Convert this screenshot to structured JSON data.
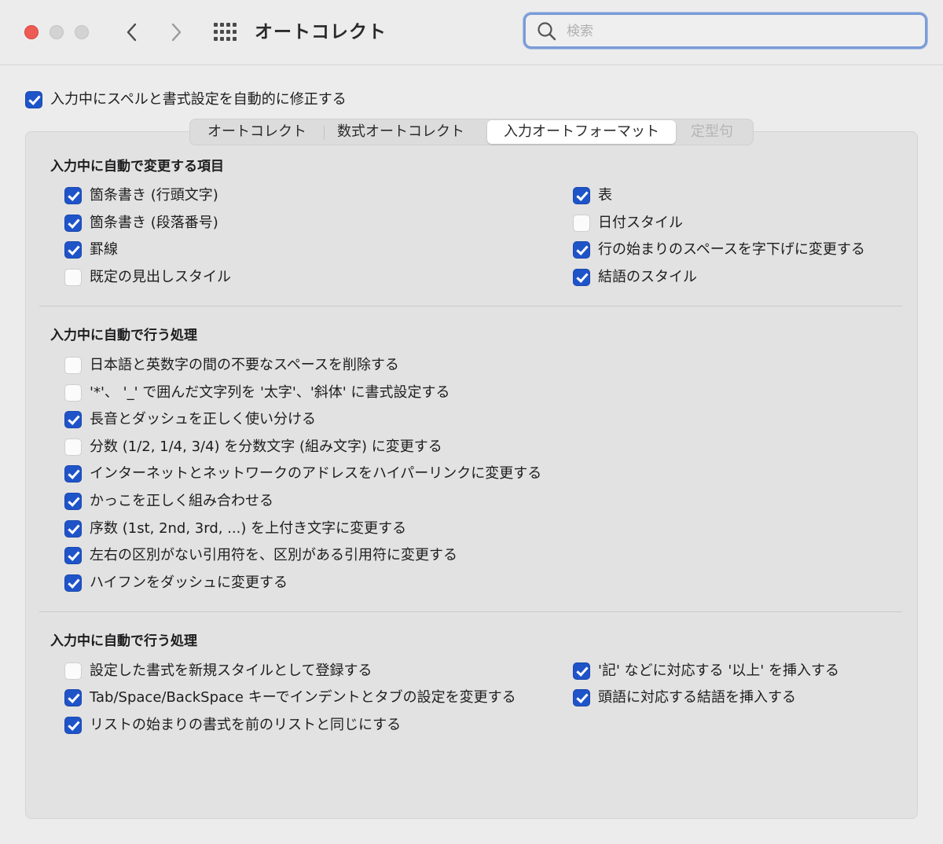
{
  "window": {
    "title": "オートコレクト",
    "search": {
      "placeholder": "検索",
      "value": ""
    }
  },
  "master": {
    "label": "入力中にスペルと書式設定を自動的に修正する",
    "checked": true
  },
  "tabs": [
    {
      "label": "オートコレクト",
      "state": "normal"
    },
    {
      "label": "数式オートコレクト",
      "state": "normal"
    },
    {
      "label": "入力オートフォーマット",
      "state": "selected"
    },
    {
      "label": "定型句",
      "state": "disabled"
    }
  ],
  "sections": [
    {
      "heading": "入力中に自動で変更する項目",
      "left": [
        {
          "label": "箇条書き (行頭文字)",
          "checked": true
        },
        {
          "label": "箇条書き (段落番号)",
          "checked": true
        },
        {
          "label": "罫線",
          "checked": true
        },
        {
          "label": "既定の見出しスタイル",
          "checked": false
        }
      ],
      "right": [
        {
          "label": "表",
          "checked": true
        },
        {
          "label": "日付スタイル",
          "checked": false
        },
        {
          "label": "行の始まりのスペースを字下げに変更する",
          "checked": true
        },
        {
          "label": "結語のスタイル",
          "checked": true
        }
      ]
    },
    {
      "heading": "入力中に自動で行う処理",
      "left": [
        {
          "label": "日本語と英数字の間の不要なスペースを削除する",
          "checked": false
        },
        {
          "label": "'*'、 '_' で囲んだ文字列を '太字'、'斜体' に書式設定する",
          "checked": false
        },
        {
          "label": "長音とダッシュを正しく使い分ける",
          "checked": true
        },
        {
          "label": "分数 (1/2, 1/4, 3/4) を分数文字 (組み文字) に変更する",
          "checked": false
        },
        {
          "label": "インターネットとネットワークのアドレスをハイパーリンクに変更する",
          "checked": true
        },
        {
          "label": "かっこを正しく組み合わせる",
          "checked": true
        },
        {
          "label": "序数 (1st, 2nd, 3rd, ...) を上付き文字に変更する",
          "checked": true
        },
        {
          "label": "左右の区別がない引用符を、区別がある引用符に変更する",
          "checked": true
        },
        {
          "label": "ハイフンをダッシュに変更する",
          "checked": true
        }
      ],
      "right": []
    },
    {
      "heading": "入力中に自動で行う処理",
      "left": [
        {
          "label": "設定した書式を新規スタイルとして登録する",
          "checked": false
        },
        {
          "label": "Tab/Space/BackSpace キーでインデントとタブの設定を変更する",
          "checked": true
        },
        {
          "label": "リストの始まりの書式を前のリストと同じにする",
          "checked": true
        }
      ],
      "right": [
        {
          "label": "'記' などに対応する '以上' を挿入する",
          "checked": true
        },
        {
          "label": "頭語に対応する結語を挿入する",
          "checked": true
        }
      ]
    }
  ],
  "colors": {
    "accent": "#1f54c9",
    "search_focus": "#7a9cd6",
    "close": "#ee5b55"
  }
}
